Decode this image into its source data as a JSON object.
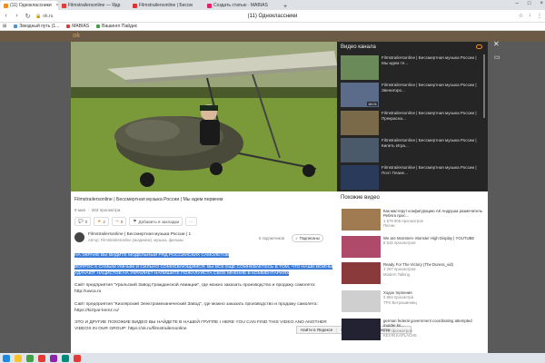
{
  "browser": {
    "tabs": [
      {
        "label": "(11) Одноклассники",
        "color": "#f28c20",
        "active": true
      },
      {
        "label": "Filmstrailersonline — Ядр",
        "color": "#e53935",
        "active": false
      },
      {
        "label": "Filmstrailersonline | Бессм",
        "color": "#d33",
        "active": false
      },
      {
        "label": "Создать статью · MABIAS",
        "color": "#e91e63",
        "active": false
      }
    ],
    "new_tab": "+",
    "url": "ok.ru",
    "page_title": "(11) Одноклассники",
    "bookmarks": [
      {
        "label": "Звездный путь (1...",
        "color": "#4a90d9"
      },
      {
        "label": "MABIAS",
        "color": "#e53935"
      },
      {
        "label": "Вашингл Пайдис",
        "color": "#43a047"
      }
    ]
  },
  "channel_sidebar": {
    "title": "Видео канала",
    "items": [
      {
        "title": "Filmstrailersonline | Бессмертная музыка России | Мы идем те...",
        "duration": "",
        "color": "#6a8a5a"
      },
      {
        "title": "Filmstrailersonline | Бессмертная музыка России | Звенигоро...",
        "duration": "18:01",
        "color": "#5b6b8a"
      },
      {
        "title": "Filmstrailersonline | Бессмертная музыка России | Прекрасна...",
        "duration": "",
        "color": "#7a6a4a"
      },
      {
        "title": "Filmstrailersonline | Бессмертная музыка России | Кипеть Игра...",
        "duration": "",
        "color": "#4a5a6a"
      },
      {
        "title": "Filmstrailersonline | Бессмертная музыка России | Поэт Плане...",
        "duration": "",
        "color": "#2a3a5a"
      }
    ]
  },
  "video": {
    "title": "Filmstrailersonline | Бессмертная музыка России | Мы идем первеем",
    "date": "8 мая",
    "views": "263 просмотра",
    "actions": [
      {
        "icon": "comment-icon",
        "count": "0"
      },
      {
        "icon": "class-icon",
        "count": "2"
      },
      {
        "icon": "share-icon",
        "count": "0"
      }
    ],
    "bookmark_label": "Добавить в закладки",
    "more": "···"
  },
  "author": {
    "name": "Filmstrailersonline | Бессмертная музыка России | 1",
    "subtitle": "Автор: Filmstrailersonline (академик), музыка, фильмы",
    "subscribers": "5 подписчиков",
    "subscribe_label": "Подписаны"
  },
  "description": {
    "hl1": "НА ЭКРАНЕ ВЫ ВИДИТЕ МОДЕЛЬНЫЙ РЯД РОССИЙСКИХ САМОЛЕТОВ",
    "hl2": "ВОПРОС К САМЫМ УМНЫМ И СИЛЬНО СОМНЕВАЮЩИМСЯ: ВЫ ВСЕ ЕЩЁ СОМНЕВАЕТЕСЬ В ТОМ, ЧТО НАШИ ВОЙНЫ УДАЧАЮТ НАЦИСТОВ НА УКРАИНЕ? НАПИШИТЕ ПОЖАЛУЙСТА СВОЁ МНЕНИЕ В КОММЕНТАРИЯХ",
    "p3": "Сайт предприятия \"Уральский Завод Гражданской Авиации\", где можно заказать производство и продажу самолета: http://uwca.ru",
    "p4": "Сайт предприятия \"Кизлярский Электромеханический Завод\", где можно заказать производство и продажу самолета: https://kizlyar-kemz.ru/",
    "p5": "ЭТО И ДРУГИЕ ПОХОЖИЕ ВИДЕО ВЫ НАЙДЕТЕ В НАШЕЙ ГРУППЕ I HERE YOU CAN FIND THIS VIDEO AND ANOTHER VIDEOS IN OUR GROUP: https://ok.ru/filmstrailersonline"
  },
  "context_menu": [
    "Найти в Яндексе",
    "Копировать",
    "В заметки"
  ],
  "similar": {
    "title": "Похожие видео",
    "items": [
      {
        "title": "Как мастерут конфигурацию АК Андруша размечатель Ребята прос...",
        "views": "1 679 905 просмотров",
        "channel": "Песни",
        "color": "#a07a50",
        "duration": ""
      },
      {
        "title": "We are Monsters- Monster High Display | YOUTUBE",
        "views": "8 515 просмотров",
        "channel": "",
        "color": "#b04a6a",
        "duration": ""
      },
      {
        "title": "Ready For The Victory (The Duress_vid)",
        "views": "3 267 просмотров",
        "channel": "Modern Talking",
        "color": "#8a3a3a",
        "duration": ""
      },
      {
        "title": "Ходок терпения",
        "views": "3 864 просмотра",
        "channel": "TPX Ветрошинниц",
        "color": "#bbb",
        "duration": ""
      },
      {
        "title": "german federal government coordinating attempted murder kri...",
        "views": "878 просмотров",
        "channel": "KEVIN KAPLACHE",
        "color": "#223",
        "duration": ""
      }
    ]
  }
}
